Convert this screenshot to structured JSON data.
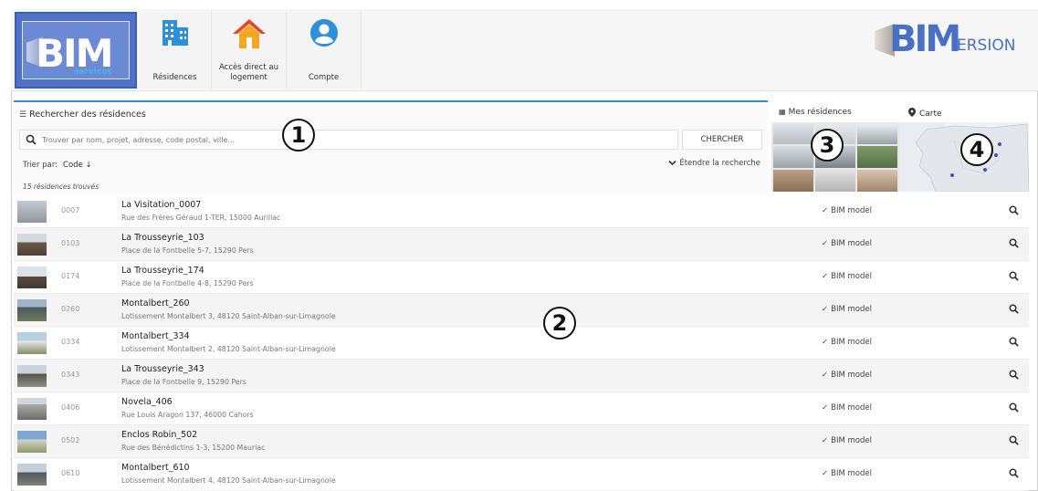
{
  "logo_left": {
    "big": "BIM",
    "sub": "services"
  },
  "logo_right": {
    "big": "BIM",
    "rest": "ERSION"
  },
  "nav": [
    {
      "label": "Résidences",
      "icon": "building-icon"
    },
    {
      "label": "Accès direct au logement",
      "icon": "home-icon"
    },
    {
      "label": "Compte",
      "icon": "user-icon"
    }
  ],
  "search": {
    "title": "Rechercher des résidences",
    "placeholder": "Trouver par nom, projet, adresse, code postal, ville...",
    "button": "CHERCHER",
    "sort_label": "Trier par:",
    "sort_value": "Code ↓",
    "extend": "Étendre la recherche",
    "count": "15 résidences trouvés"
  },
  "tabs": {
    "residences": "Mes résidences",
    "map": "Carte"
  },
  "callouts": [
    "1",
    "2",
    "3",
    "4"
  ],
  "colors": {
    "accent": "#2f8fd8",
    "logo_blue": "#4f72c8",
    "home_red": "#e8442a",
    "home_orange": "#f5a623",
    "user_blue": "#2f8fd8",
    "building_blue": "#2f8fd8"
  },
  "residences": [
    {
      "code": "0007",
      "name": "La Visitation_0007",
      "address": "Rue des Frères Géraud 1-TER, 15000 Aurillac",
      "bim": "BIM model"
    },
    {
      "code": "0103",
      "name": "La Trousseyrie_103",
      "address": "Place de la Fontbelle 5-7, 15290 Pers",
      "bim": "BIM model"
    },
    {
      "code": "0174",
      "name": "La Trousseyrie_174",
      "address": "Place de la Fontbelle 4-8, 15290 Pers",
      "bim": "BIM model"
    },
    {
      "code": "0260",
      "name": "Montalbert_260",
      "address": "Lotissement Montalbert 3, 48120 Saint-Alban-sur-Limagnole",
      "bim": "BIM model"
    },
    {
      "code": "0334",
      "name": "Montalbert_334",
      "address": "Lotissement Montalbert 2, 48120 Saint-Alban-sur-Limagnole",
      "bim": "BIM model"
    },
    {
      "code": "0343",
      "name": "La Trousseyrie_343",
      "address": "Place de la Fontbelle 9, 15290 Pers",
      "bim": "BIM model"
    },
    {
      "code": "0406",
      "name": "Novela_406",
      "address": "Rue Louis Aragon 137, 46000 Cahors",
      "bim": "BIM model"
    },
    {
      "code": "0502",
      "name": "Enclos Robin_502",
      "address": "Rue des Bénédictins 1-3, 15200 Mauriac",
      "bim": "BIM model"
    },
    {
      "code": "0610",
      "name": "Montalbert_610",
      "address": "Lotissement Montalbert 4, 48120 Saint-Alban-sur-Limagnole",
      "bim": "BIM model"
    }
  ]
}
